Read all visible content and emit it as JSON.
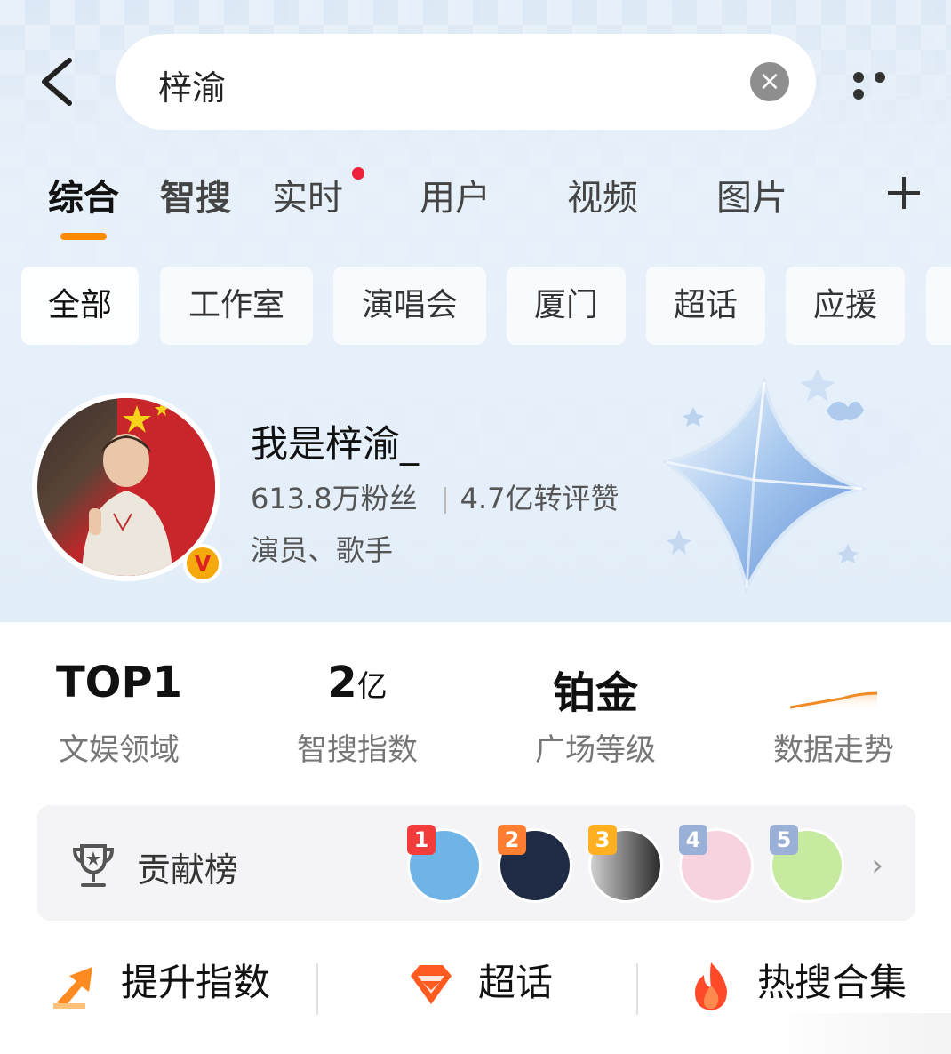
{
  "search": {
    "query": "梓渝"
  },
  "tabs": [
    {
      "label": "综合",
      "active": true
    },
    {
      "label": "智搜"
    },
    {
      "label": "实时",
      "has_dot": true
    },
    {
      "label": "用户"
    },
    {
      "label": "视频"
    },
    {
      "label": "图片"
    }
  ],
  "tab_add_icon": "plus-icon",
  "filters": [
    "全部",
    "工作室",
    "演唱会",
    "厦门",
    "超话",
    "应援"
  ],
  "profile": {
    "name": "我是梓渝_",
    "fans": "613.8万粉丝",
    "engagement": "4.7亿转评赞",
    "description": "演员、歌手"
  },
  "metrics": [
    {
      "value": "TOP1",
      "label": "文娱领域"
    },
    {
      "value": "2",
      "unit": "亿",
      "label": "智搜指数"
    },
    {
      "value": "铂金",
      "label": "广场等级"
    },
    {
      "label": "数据走势"
    }
  ],
  "contrib": {
    "label": "贡献榜",
    "ranks": [
      "1",
      "2",
      "3",
      "4",
      "5"
    ]
  },
  "actions": [
    {
      "label": "提升指数",
      "icon": "arrow-up-icon"
    },
    {
      "label": "超话",
      "icon": "diamond-icon"
    },
    {
      "label": "热搜合集",
      "icon": "flame-icon"
    }
  ],
  "colors": {
    "accent": "#ff8a00",
    "dot": "#f0213a",
    "rank1": "#f23c3c",
    "rank2": "#ff7e30",
    "rank3": "#ffb020",
    "rank4": "#9ab0d6",
    "rank5": "#9ab0d6"
  }
}
